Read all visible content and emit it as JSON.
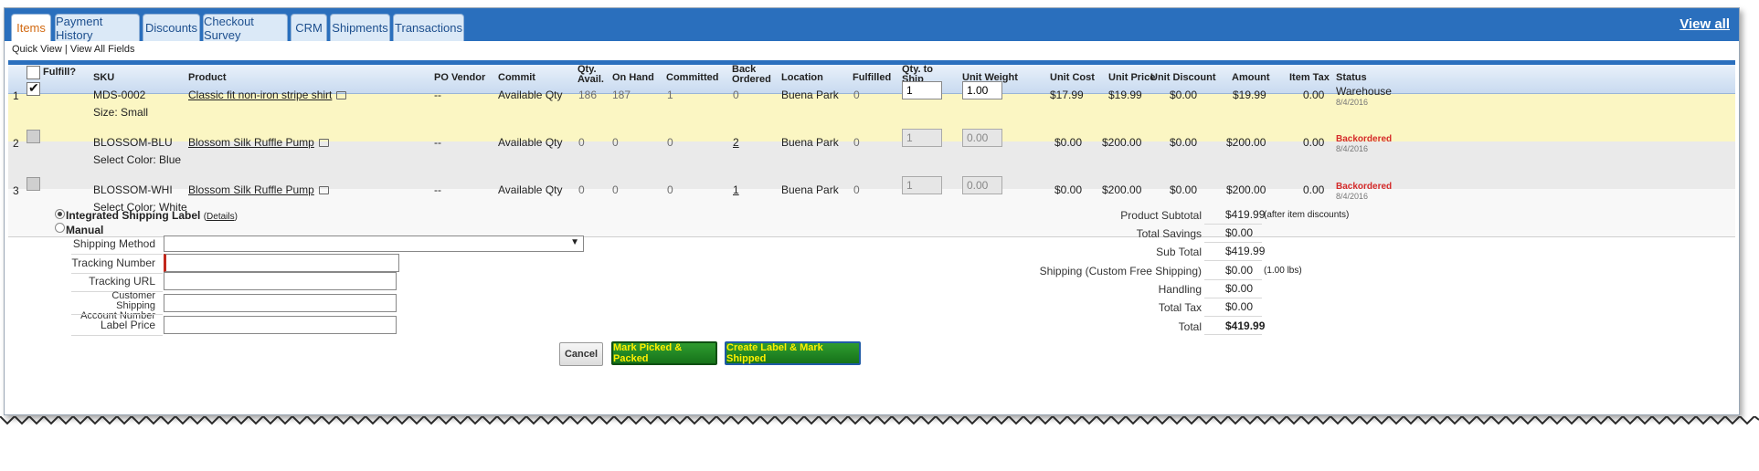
{
  "tabs": [
    {
      "label": "Items",
      "active": true
    },
    {
      "label": "Payment History"
    },
    {
      "label": "Discounts"
    },
    {
      "label": "Checkout Survey"
    },
    {
      "label": "CRM"
    },
    {
      "label": "Shipments"
    },
    {
      "label": "Transactions"
    }
  ],
  "view_all_label": "View all",
  "quick_view": {
    "quick": "Quick View",
    "separator": " | ",
    "all": "View All Fields"
  },
  "columns": {
    "fulfill": "Fulfill?",
    "sku": "SKU",
    "product": "Product",
    "po_vendor": "PO Vendor",
    "commit": "Commit",
    "qty_avail": "Qty. Avail.",
    "on_hand": "On Hand",
    "committed": "Committed",
    "back_ordered": "Back Ordered",
    "location": "Location",
    "fulfilled": "Fulfilled",
    "qty_to_ship": "Qty. to Ship",
    "unit_weight": "Unit Weight",
    "unit_cost": "Unit Cost",
    "unit_price": "Unit Price",
    "unit_discount": "Unit Discount",
    "amount": "Amount",
    "item_tax": "Item Tax",
    "status": "Status"
  },
  "rows": [
    {
      "num": "1",
      "checked": true,
      "sku": "MDS-0002",
      "option_label": "Size:",
      "option_value": "Small",
      "product": "Classic fit non-iron stripe shirt",
      "po_vendor": "--",
      "commit": "Available Qty",
      "qty_avail": "186",
      "on_hand": "187",
      "committed": "1",
      "back_ordered": "0",
      "location": "Buena Park",
      "fulfilled": "0",
      "qty_to_ship": "1",
      "unit_weight": "1.00",
      "unit_cost": "$17.99",
      "unit_price": "$19.99",
      "unit_discount": "$0.00",
      "amount": "$19.99",
      "item_tax": "0.00",
      "status": "Warehouse",
      "status_date": "8/4/2016"
    },
    {
      "num": "2",
      "checked": false,
      "sku": "BLOSSOM-BLU",
      "option_label": "Select Color:",
      "option_value": "Blue",
      "product": "Blossom Silk Ruffle Pump",
      "po_vendor": "--",
      "commit": "Available Qty",
      "qty_avail": "0",
      "on_hand": "0",
      "committed": "0",
      "back_ordered": "2",
      "location": "Buena Park",
      "fulfilled": "0",
      "qty_to_ship": "1",
      "unit_weight": "0.00",
      "unit_cost": "$0.00",
      "unit_price": "$200.00",
      "unit_discount": "$0.00",
      "amount": "$200.00",
      "item_tax": "0.00",
      "status": "Backordered",
      "status_date": "8/4/2016"
    },
    {
      "num": "3",
      "checked": false,
      "sku": "BLOSSOM-WHI",
      "option_label": "Select Color:",
      "option_value": "White",
      "product": "Blossom Silk Ruffle Pump",
      "po_vendor": "--",
      "commit": "Available Qty",
      "qty_avail": "0",
      "on_hand": "0",
      "committed": "0",
      "back_ordered": "1",
      "location": "Buena Park",
      "fulfilled": "0",
      "qty_to_ship": "1",
      "unit_weight": "0.00",
      "unit_cost": "$0.00",
      "unit_price": "$200.00",
      "unit_discount": "$0.00",
      "amount": "$200.00",
      "item_tax": "0.00",
      "status": "Backordered",
      "status_date": "8/4/2016"
    }
  ],
  "shipping": {
    "integrated_label": "Integrated Shipping Label",
    "details_label": "Details",
    "manual_label": "Manual",
    "method_label": "Shipping Method",
    "method_value": "",
    "tracking_number_label": "Tracking Number",
    "tracking_number_value": "",
    "tracking_url_label": "Tracking URL",
    "tracking_url_value": "",
    "customer_account_label_1": "Customer Shipping",
    "customer_account_label_2": "Account Number",
    "customer_account_value": "",
    "label_price_label": "Label Price",
    "label_price_value": ""
  },
  "totals": {
    "product_subtotal_label": "Product Subtotal",
    "product_subtotal": "$419.99",
    "product_subtotal_note": "(after item discounts)",
    "total_savings_label": "Total Savings",
    "total_savings": "$0.00",
    "sub_total_label": "Sub Total",
    "sub_total": "$419.99",
    "shipping_label": "Shipping (Custom Free Shipping)",
    "shipping": "$0.00",
    "shipping_note": "(1.00 lbs)",
    "handling_label": "Handling",
    "handling": "$0.00",
    "total_tax_label": "Total Tax",
    "total_tax": "$0.00",
    "total_label": "Total",
    "total": "$419.99"
  },
  "buttons": {
    "cancel": "Cancel",
    "mark_picked": "Mark Picked & Packed",
    "create_label": "Create Label & Mark Shipped"
  }
}
